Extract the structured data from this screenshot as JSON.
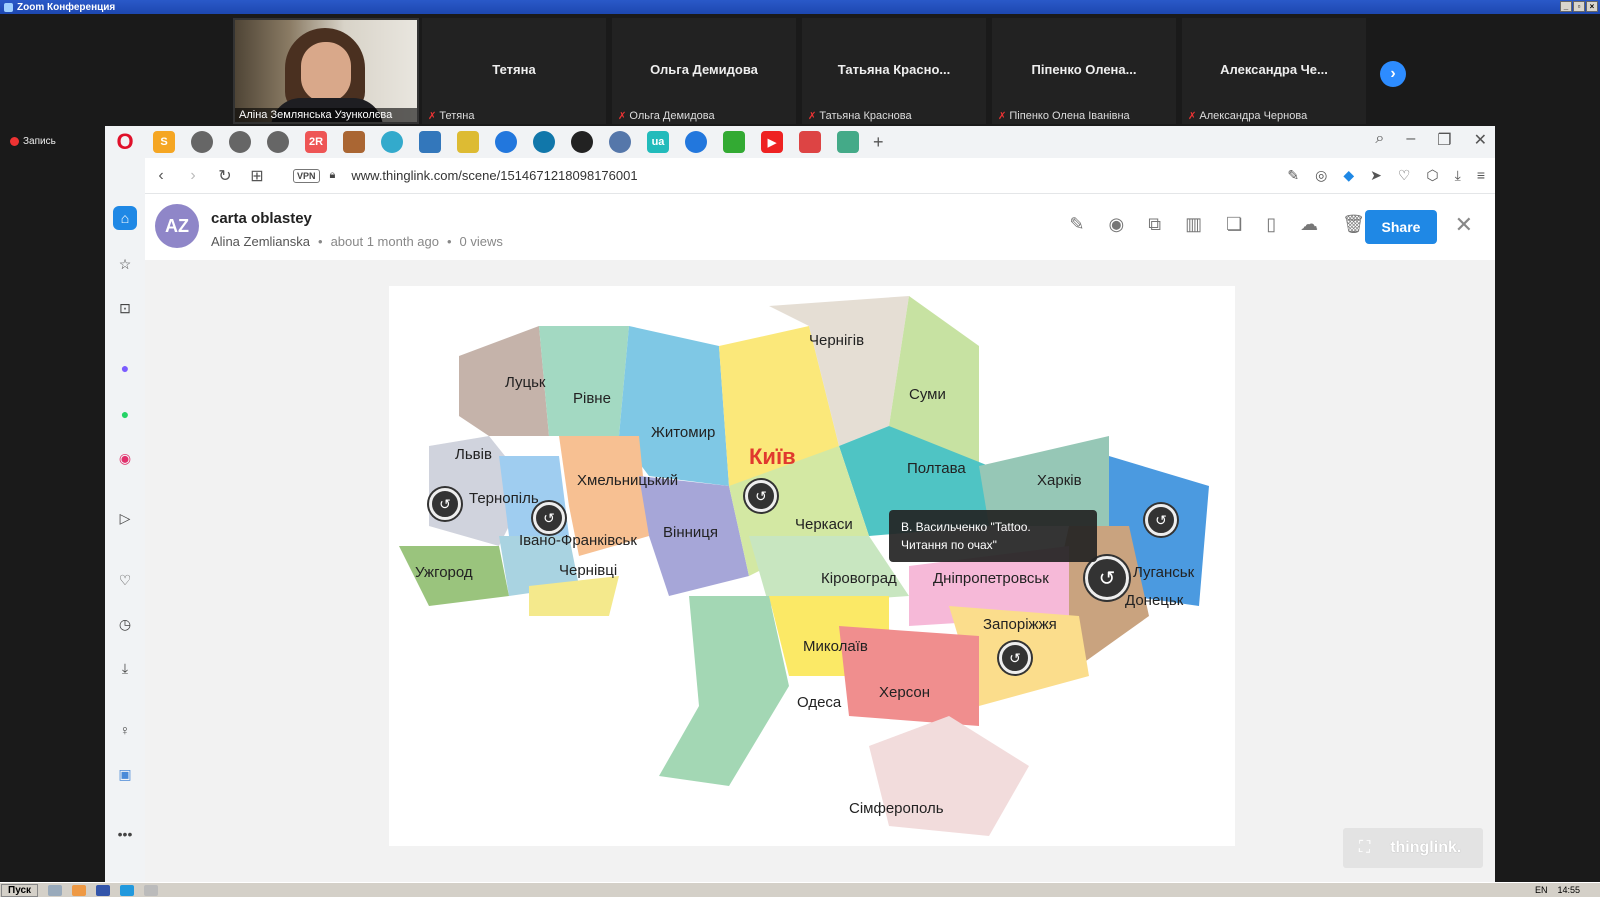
{
  "zoom": {
    "window_title": "Zoom Конференция",
    "recording_label": "Запись",
    "participants": [
      {
        "display": "",
        "label": "Аліна Землянська Узунколєва",
        "video": true
      },
      {
        "display": "Тетяна",
        "label": "Тетяна"
      },
      {
        "display": "Ольга Демидова",
        "label": "Ольга Демидова"
      },
      {
        "display": "Татьяна Красно...",
        "label": "Татьяна Краснова"
      },
      {
        "display": "Піпенко Олена...",
        "label": "Піпенко Олена Іванівна"
      },
      {
        "display": "Александра Че...",
        "label": "Александра Чернова"
      }
    ]
  },
  "browser": {
    "url": "www.thinglink.com/scene/1514671218098176001",
    "vpn_label": "VPN"
  },
  "scene": {
    "avatar_initials": "AZ",
    "title": "carta oblastey",
    "author": "Alina Zemlianska",
    "age": "about 1 month ago",
    "views": "0 views",
    "share_label": "Share"
  },
  "map": {
    "cities": [
      {
        "name": "Луцьк"
      },
      {
        "name": "Рівне"
      },
      {
        "name": "Житомир"
      },
      {
        "name": "Чернігів"
      },
      {
        "name": "Суми"
      },
      {
        "name": "Київ"
      },
      {
        "name": "Львів"
      },
      {
        "name": "Тернопіль"
      },
      {
        "name": "Хмельницький"
      },
      {
        "name": "Полтава"
      },
      {
        "name": "Харків"
      },
      {
        "name": "Івано-Франківськ"
      },
      {
        "name": "Вінниця"
      },
      {
        "name": "Черкаси"
      },
      {
        "name": "Ужгород"
      },
      {
        "name": "Чернівці"
      },
      {
        "name": "Кіровоград"
      },
      {
        "name": "Дніпропетровськ"
      },
      {
        "name": "Луганськ"
      },
      {
        "name": "Донецьк"
      },
      {
        "name": "Запоріжжя"
      },
      {
        "name": "Миколаїв"
      },
      {
        "name": "Херсон"
      },
      {
        "name": "Одеса"
      },
      {
        "name": "Сімферополь"
      }
    ],
    "tooltip_line1": "В. Васильченко \"Tattoo.",
    "tooltip_line2": "Читання по очах\""
  },
  "badge": {
    "brand": "thinglink."
  },
  "taskbar": {
    "start_label": "Пуск",
    "lang": "EN",
    "time": "14:55"
  }
}
